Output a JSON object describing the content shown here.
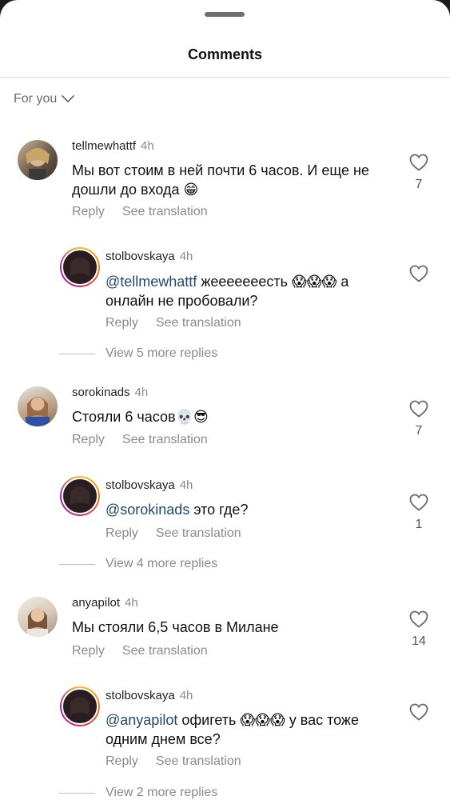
{
  "header": {
    "title": "Comments"
  },
  "filter": {
    "label": "For you"
  },
  "comments": [
    {
      "username": "tellmewhattf",
      "time": "4h",
      "text": "Мы вот стоим в ней почти 6 часов. И еще не дошли до входа 😁",
      "reply_label": "Reply",
      "translate_label": "See translation",
      "likes": "7",
      "replies": [
        {
          "username": "stolbovskaya",
          "time": "4h",
          "mention": "@tellmewhattf",
          "text": " жееееееесть 😱😱😱 а онлайн не пробовали?",
          "reply_label": "Reply",
          "translate_label": "See translation"
        }
      ],
      "view_more": "View 5 more replies"
    },
    {
      "username": "sorokinads",
      "time": "4h",
      "text": "Стояли 6 часов💀😎",
      "reply_label": "Reply",
      "translate_label": "See translation",
      "likes": "7",
      "replies": [
        {
          "username": "stolbovskaya",
          "time": "4h",
          "mention": "@sorokinads",
          "text": " это где?",
          "reply_label": "Reply",
          "translate_label": "See translation",
          "likes": "1"
        }
      ],
      "view_more": "View 4 more replies"
    },
    {
      "username": "anyapilot",
      "time": "4h",
      "text": "Мы стояли 6,5 часов в Милане",
      "reply_label": "Reply",
      "translate_label": "See translation",
      "likes": "14",
      "replies": [
        {
          "username": "stolbovskaya",
          "time": "4h",
          "mention": "@anyapilot",
          "text": " офигеть 😱😱😱 у вас тоже одним днем все?",
          "reply_label": "Reply",
          "translate_label": "See translation"
        }
      ],
      "view_more": "View 2 more replies"
    }
  ],
  "icons": {
    "like": "heart-outline-icon",
    "filter": "chevron-down-icon"
  },
  "colors": {
    "mention": "#22486e",
    "muted": "#8a8a8a",
    "story_ring": "#d6246b"
  }
}
